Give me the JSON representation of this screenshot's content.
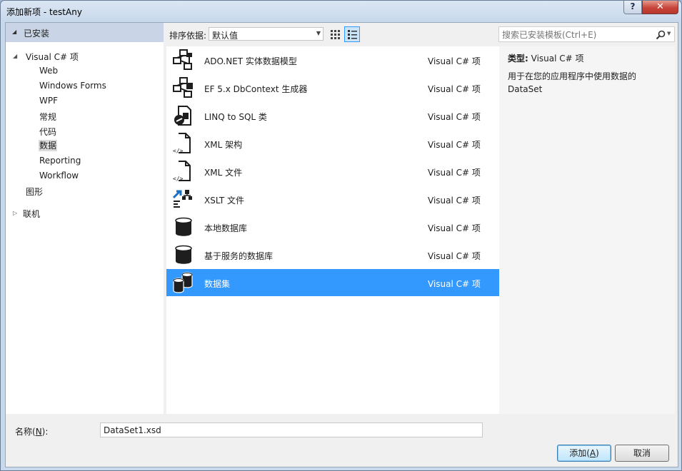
{
  "window": {
    "title": "添加新项 - testAny",
    "help_label": "?",
    "close_label": "✕"
  },
  "tree": {
    "header": "已安装",
    "root": "Visual C# 项",
    "children": [
      "Web",
      "Windows Forms",
      "WPF",
      "常规",
      "代码",
      "数据",
      "Reporting",
      "Workflow"
    ],
    "selected": "数据",
    "graphics": "图形",
    "online": "联机"
  },
  "toolbar": {
    "sort_label": "排序依据:",
    "sort_value": "默认值"
  },
  "search": {
    "placeholder": "搜索已安装模板(Ctrl+E)"
  },
  "templates": [
    {
      "name": "ADO.NET 实体数据模型",
      "lang": "Visual C# 项",
      "icon": "entity-model-icon"
    },
    {
      "name": "EF 5.x DbContext 生成器",
      "lang": "Visual C# 项",
      "icon": "dbcontext-generator-icon"
    },
    {
      "name": "LINQ to SQL 类",
      "lang": "Visual C# 项",
      "icon": "linq-to-sql-icon"
    },
    {
      "name": "XML 架构",
      "lang": "Visual C# 项",
      "icon": "xml-schema-icon"
    },
    {
      "name": "XML 文件",
      "lang": "Visual C# 项",
      "icon": "xml-file-icon"
    },
    {
      "name": "XSLT 文件",
      "lang": "Visual C# 项",
      "icon": "xslt-file-icon"
    },
    {
      "name": "本地数据库",
      "lang": "Visual C# 项",
      "icon": "local-database-icon"
    },
    {
      "name": "基于服务的数据库",
      "lang": "Visual C# 项",
      "icon": "service-database-icon"
    },
    {
      "name": "数据集",
      "lang": "Visual C# 项",
      "icon": "dataset-icon",
      "selected": true
    }
  ],
  "details": {
    "type_label": "类型:",
    "type_value": "Visual C# 项",
    "description": "用于在您的应用程序中使用数据的 DataSet"
  },
  "bottom": {
    "name_label_pre": "名称(",
    "name_label_key": "N",
    "name_label_post": "):",
    "name_value": "DataSet1.xsd",
    "add_pre": "添加(",
    "add_key": "A",
    "add_post": ")",
    "cancel_label": "取消"
  },
  "colors": {
    "selection": "#3399ff",
    "tree_header": "#c9d5e6"
  }
}
